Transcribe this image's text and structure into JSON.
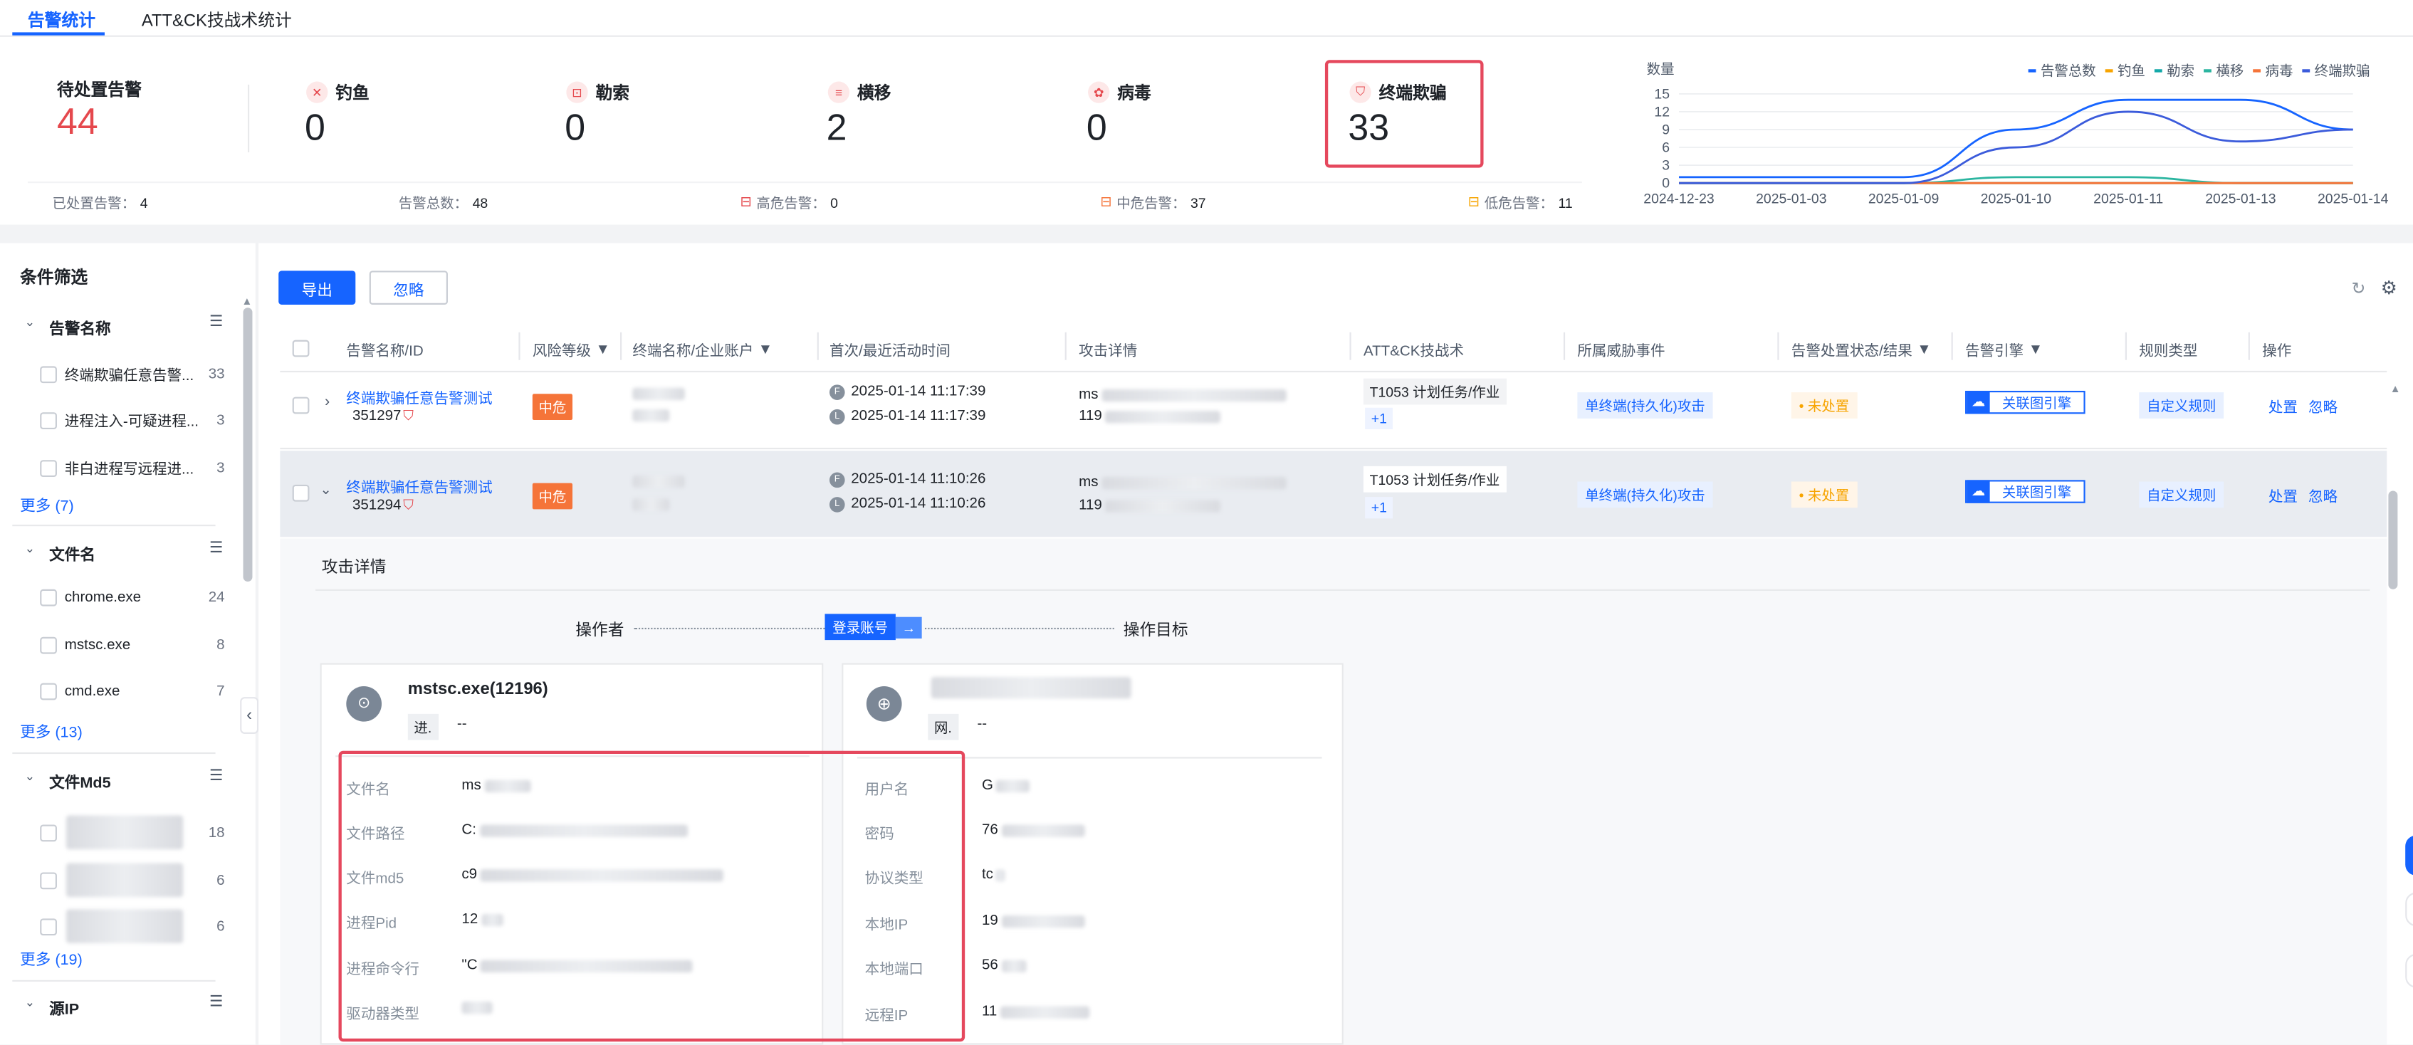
{
  "tabs": [
    "告警统计",
    "ATT&CK技战术统计"
  ],
  "stats": {
    "pending_label": "待处置告警",
    "pending_value": "44",
    "cards": [
      {
        "label": "钓鱼",
        "value": "0",
        "icon": "fish-hook-icon"
      },
      {
        "label": "勒索",
        "value": "0",
        "icon": "lock-icon"
      },
      {
        "label": "横移",
        "value": "2",
        "icon": "list-icon"
      },
      {
        "label": "病毒",
        "value": "0",
        "icon": "virus-icon"
      },
      {
        "label": "终端欺骗",
        "value": "33",
        "icon": "shield-icon"
      }
    ],
    "subs": [
      {
        "label": "已处置告警：",
        "value": "4"
      },
      {
        "label": "告警总数：",
        "value": "48"
      },
      {
        "label": "高危告警：",
        "value": "0"
      },
      {
        "label": "中危告警：",
        "value": "37"
      },
      {
        "label": "低危告警：",
        "value": "11"
      }
    ]
  },
  "chart_data": {
    "type": "line",
    "ylabel": "数量",
    "ylim": [
      0,
      15
    ],
    "yticks": [
      "15",
      "12",
      "9",
      "6",
      "3",
      "0"
    ],
    "x": [
      "2024-12-23",
      "2025-01-03",
      "2025-01-09",
      "2025-01-10",
      "2025-01-11",
      "2025-01-13",
      "2025-01-14"
    ],
    "legend_position": "top-right",
    "series": [
      {
        "name": "告警总数",
        "color": "#1664ff",
        "values": [
          1,
          1,
          1,
          9,
          14,
          14,
          9
        ]
      },
      {
        "name": "钓鱼",
        "color": "#f7a400",
        "values": [
          0,
          0,
          0,
          0,
          0,
          0,
          0
        ]
      },
      {
        "name": "勒索",
        "color": "#14a9a9",
        "values": [
          0,
          0,
          0,
          0,
          0,
          0,
          0
        ]
      },
      {
        "name": "横移",
        "color": "#2bb5a0",
        "values": [
          0,
          0,
          0,
          1,
          1,
          0,
          0
        ]
      },
      {
        "name": "病毒",
        "color": "#f57439",
        "values": [
          0,
          0,
          0,
          0,
          0,
          0,
          0
        ]
      },
      {
        "name": "终端欺骗",
        "color": "#3b5bdb",
        "values": [
          0,
          0,
          0,
          6,
          12,
          7,
          9
        ]
      }
    ]
  },
  "sidebar": {
    "title": "条件筛选",
    "groups": [
      {
        "title": "告警名称",
        "items": [
          {
            "label": "终端欺骗任意告警...",
            "count": "33"
          },
          {
            "label": "进程注入-可疑进程...",
            "count": "3"
          },
          {
            "label": "非白进程写远程进...",
            "count": "3"
          }
        ],
        "more": "更多 (7)"
      },
      {
        "title": "文件名",
        "items": [
          {
            "label": "chrome.exe",
            "count": "24"
          },
          {
            "label": "mstsc.exe",
            "count": "8"
          },
          {
            "label": "cmd.exe",
            "count": "7"
          }
        ],
        "more": "更多 (13)"
      },
      {
        "title": "文件Md5",
        "items": [
          {
            "label": "",
            "count": "18"
          },
          {
            "label": "",
            "count": "6"
          },
          {
            "label": "",
            "count": "6"
          }
        ],
        "more": "更多 (19)"
      },
      {
        "title": "源IP",
        "items": [],
        "more": ""
      }
    ]
  },
  "toolbar": {
    "export": "导出",
    "ignore": "忽略"
  },
  "columns": [
    "告警名称/ID",
    "风险等级",
    "终端名称/企业账户",
    "首次/最近活动时间",
    "攻击详情",
    "ATT&CK技战术",
    "所属威胁事件",
    "告警处置状态/结果",
    "告警引擎",
    "规则类型",
    "操作"
  ],
  "rows": [
    {
      "name": "终端欺骗任意告警测试",
      "id": "351297",
      "risk": "中危",
      "first": "2025-01-14 11:17:39",
      "last": "2025-01-14 11:17:39",
      "attack_prefix": "ms",
      "attack_prefix2": "119",
      "tactic": "T1053 计划任务/作业",
      "tactic_more": "+1",
      "event": "单终端(持久化)攻击",
      "status": "未处置",
      "engine": "关联图引擎",
      "rule": "自定义规则",
      "op1": "处置",
      "op2": "忽略"
    },
    {
      "name": "终端欺骗任意告警测试",
      "id": "351294",
      "risk": "中危",
      "first": "2025-01-14 11:10:26",
      "last": "2025-01-14 11:10:26",
      "attack_prefix": "ms",
      "attack_prefix2": "119",
      "tactic": "T1053 计划任务/作业",
      "tactic_more": "+1",
      "event": "单终端(持久化)攻击",
      "status": "未处置",
      "engine": "关联图引擎",
      "rule": "自定义规则",
      "op1": "处置",
      "op2": "忽略"
    }
  ],
  "detail": {
    "title": "攻击详情",
    "operator": "操作者",
    "target": "操作目标",
    "link_label": "登录账号",
    "left_card": {
      "title": "mstsc.exe(12196)",
      "tag": "进.",
      "tag_value": "--",
      "fields": [
        {
          "k": "文件名",
          "v": "ms"
        },
        {
          "k": "文件路径",
          "v": "C:"
        },
        {
          "k": "文件md5",
          "v": "c9"
        },
        {
          "k": "进程Pid",
          "v": "12"
        },
        {
          "k": "进程命令行",
          "v": "\"C"
        },
        {
          "k": "驱动器类型",
          "v": ""
        }
      ]
    },
    "right_card": {
      "title": "",
      "tag": "网.",
      "tag_value": "--",
      "fields": [
        {
          "k": "用户名",
          "v": "G"
        },
        {
          "k": "密码",
          "v": "76"
        },
        {
          "k": "协议类型",
          "v": "tc"
        },
        {
          "k": "本地IP",
          "v": "19"
        },
        {
          "k": "本地端口",
          "v": "56"
        },
        {
          "k": "远程IP",
          "v": "11"
        }
      ]
    }
  }
}
